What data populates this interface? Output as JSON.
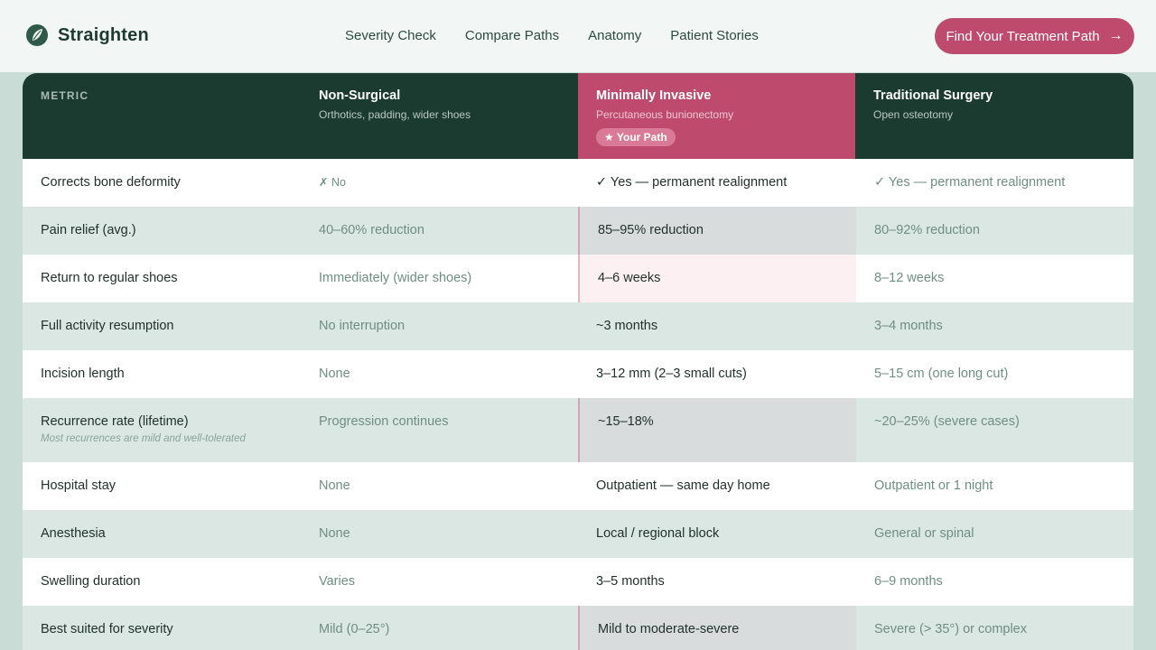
{
  "brand": {
    "name": "Straighten"
  },
  "nav": {
    "items": [
      "Severity Check",
      "Compare Paths",
      "Anatomy",
      "Patient Stories"
    ]
  },
  "cta": {
    "label": "Find Your Treatment Path",
    "arrow": "→"
  },
  "table": {
    "metric_header": "METRIC",
    "columns": [
      {
        "title": "Non-Surgical",
        "subtitle": "Orthotics, padding, wider shoes"
      },
      {
        "title": "Minimally Invasive",
        "subtitle": "Percutaneous bunionectomy",
        "badge": "★ Your Path"
      },
      {
        "title": "Traditional Surgery",
        "subtitle": "Open osteotomy"
      }
    ],
    "rows": [
      {
        "metric": "Corrects bone deformity",
        "values": [
          "✗ No",
          "✓ Yes — permanent realignment",
          "✓ Yes — permanent realignment"
        ]
      },
      {
        "metric": "Pain relief (avg.)",
        "values": [
          "40–60% reduction",
          "85–95% reduction",
          "80–92% reduction"
        ]
      },
      {
        "metric": "Return to regular shoes",
        "values": [
          "Immediately (wider shoes)",
          "4–6 weeks",
          "8–12 weeks"
        ]
      },
      {
        "metric": "Full activity resumption",
        "values": [
          "No interruption",
          "~3 months",
          "3–4 months"
        ]
      },
      {
        "metric": "Incision length",
        "values": [
          "None",
          "3–12 mm (2–3 small cuts)",
          "5–15 cm (one long cut)"
        ]
      },
      {
        "metric": "Recurrence rate (lifetime)",
        "note": "Most recurrences are mild and well-tolerated",
        "values": [
          "Progression continues",
          "~15–18%",
          "~20–25% (severe cases)"
        ]
      },
      {
        "metric": "Hospital stay",
        "values": [
          "None",
          "Outpatient — same day home",
          "Outpatient or 1 night"
        ]
      },
      {
        "metric": "Anesthesia",
        "values": [
          "None",
          "Local / regional block",
          "General or spinal"
        ]
      },
      {
        "metric": "Swelling duration",
        "values": [
          "Varies",
          "3–5 months",
          "6–9 months"
        ]
      },
      {
        "metric": "Best suited for severity",
        "values": [
          "Mild (0–25°)",
          "Mild to moderate-severe",
          "Severe (> 35°) or complex"
        ]
      }
    ]
  },
  "colors": {
    "primary_dark": "#1b3b31",
    "accent": "#be4b6d",
    "row_alt": "#dbe7e3"
  },
  "icons": {
    "brand": "leaf-logo-icon"
  }
}
